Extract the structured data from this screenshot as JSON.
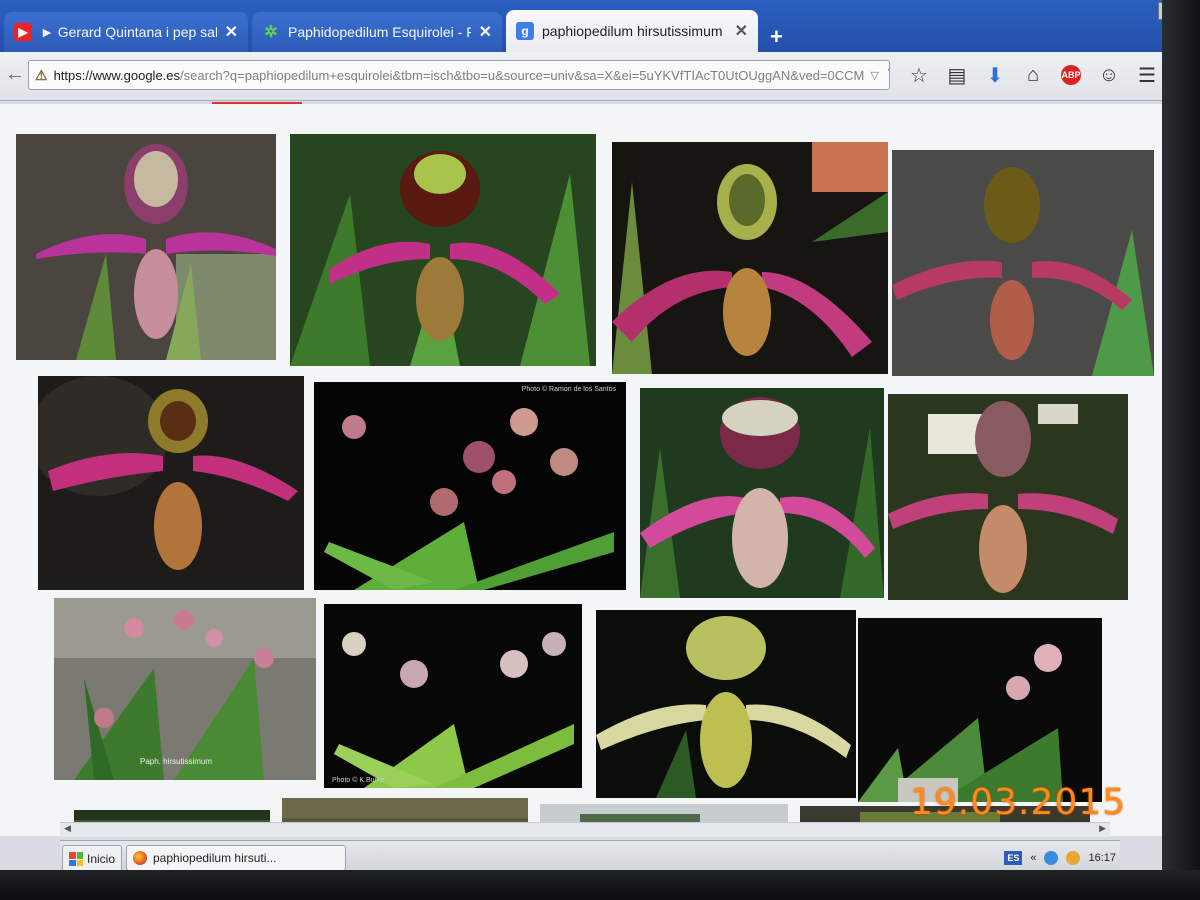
{
  "browser": {
    "tabs": [
      {
        "title": "► Gerard Quintana i pep sala-...",
        "icon": "youtube-icon",
        "active": false
      },
      {
        "title": "Paphidopedilum Esquirolei - Fo...",
        "icon": "leaf-favicon-icon",
        "active": false
      },
      {
        "title": "paphiopedilum hirsutissimum - ...",
        "icon": "google-favicon-icon",
        "active": true
      }
    ],
    "new_tab_label": "+",
    "close_glyph": "✕",
    "url_host": "https://www.google.es",
    "url_path": "/search?q=paphiopedilum+esquirolei&tbm=isch&tbo=u&source=univ&sa=X&ei=5uYKVfTIAcT0UtOUggAN&ved=0CCM"
  },
  "taskbar": {
    "start_label": "Inicio",
    "task_label": "paphiopedilum hirsuti...",
    "lang": "ES",
    "chevron": "«",
    "clock": "16:17"
  },
  "image_results": {
    "credit_2_2": "Photo © Ramon de los Santos",
    "credit_3_2": "Photo © K.Burke",
    "caption_3_1": "Paph. hirsutissimum"
  },
  "camera_stamp": "19.03.2015"
}
